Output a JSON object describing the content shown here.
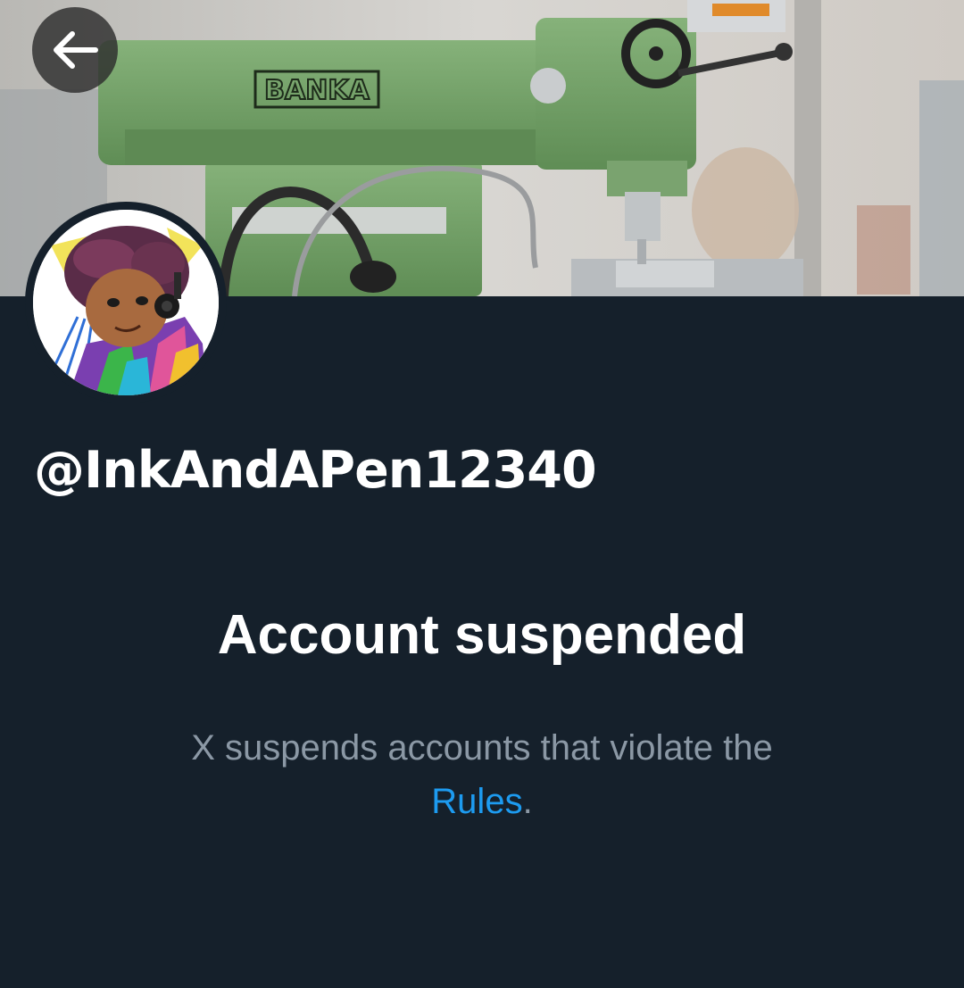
{
  "header": {
    "back_icon": "arrow-left-icon",
    "banner_logo_text": "BANKA"
  },
  "profile": {
    "handle": "@InkAndAPen12340"
  },
  "suspension": {
    "title": "Account suspended",
    "description_prefix": "X suspends accounts that violate the",
    "rules_link": "Rules",
    "description_suffix": "."
  },
  "colors": {
    "background": "#15202b",
    "secondary_text": "#8b98a5",
    "link": "#1d9bf0",
    "machine_green": "#6f9e63"
  }
}
